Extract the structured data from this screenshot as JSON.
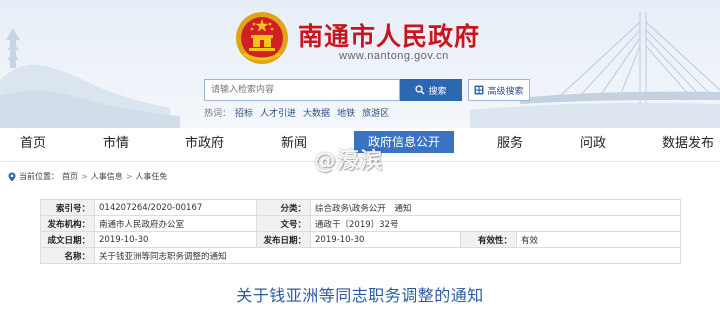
{
  "header": {
    "site_title": "南通市人民政府",
    "site_url": "www.nantong.gov.cn",
    "search": {
      "placeholder": "请输入检索内容",
      "button_label": "搜索",
      "advanced_label": "高级搜索"
    },
    "hot_label": "热词：",
    "hot_words": [
      "招标",
      "人才引进",
      "大数据",
      "地铁",
      "旅游区"
    ]
  },
  "nav": {
    "items": [
      "首页",
      "市情",
      "市政府",
      "新闻",
      "政府信息公开",
      "服务",
      "问政",
      "数据发布"
    ],
    "active_index": 4
  },
  "watermark": "@濠滨",
  "breadcrumb": {
    "label": "当前位置：",
    "items": [
      "首页",
      "人事信息",
      "人事任免"
    ]
  },
  "meta": {
    "index_no_label": "索引号：",
    "index_no": "014207264/2020-00167",
    "category_label": "分类：",
    "category": "综合政务\\政务公开　通知",
    "issuer_label": "发布机构：",
    "issuer": "南通市人民政府办公室",
    "doc_no_label": "文号：",
    "doc_no": "通政干〔2019〕32号",
    "created_label": "成文日期：",
    "created": "2019-10-30",
    "published_label": "发布日期：",
    "published": "2019-10-30",
    "validity_label": "有效性：",
    "validity": "有效",
    "name_label": "名称：",
    "name": "关于钱亚洲等同志职务调整的通知"
  },
  "document": {
    "title": "关于钱亚洲等同志职务调整的通知"
  },
  "colors": {
    "brand_red": "#c8161e",
    "brand_blue": "#2c67b1",
    "active_nav": "#3a74c0",
    "title_blue": "#2c5c9f"
  }
}
